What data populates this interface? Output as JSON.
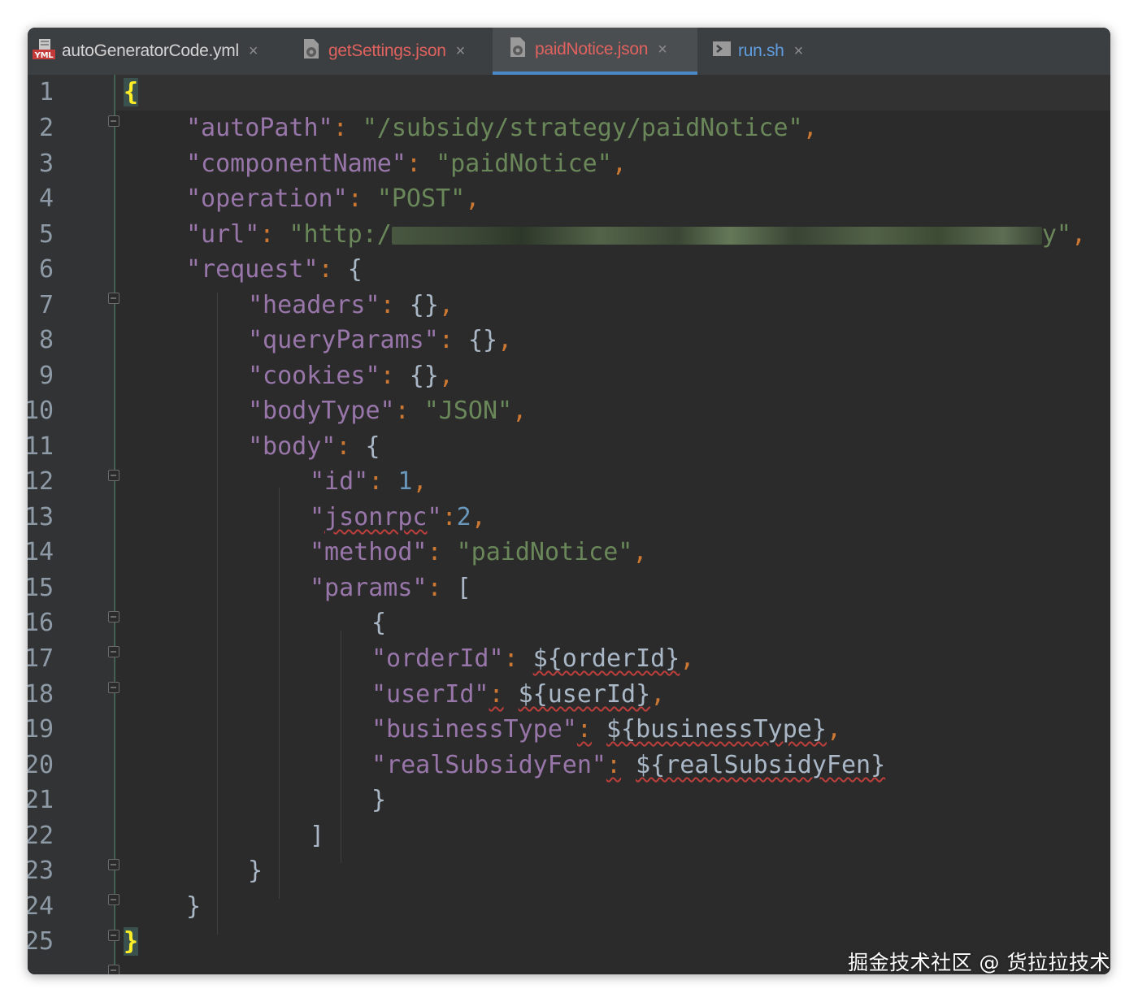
{
  "tabs": [
    {
      "label": "autoGeneratorCode.yml",
      "icon": "yml-file-icon",
      "color": "#d3d3d3",
      "active": false,
      "close": "×"
    },
    {
      "label": "getSettings.json",
      "icon": "json-file-icon",
      "color": "#e0625f",
      "active": false,
      "close": "×"
    },
    {
      "label": "paidNotice.json",
      "icon": "json-file-icon",
      "color": "#e0625f",
      "active": true,
      "close": "×"
    },
    {
      "label": "run.sh",
      "icon": "shell-file-icon",
      "color": "#5f9de0",
      "active": false,
      "close": "×"
    }
  ],
  "yml_badge": "YML",
  "line_numbers": [
    "1",
    "2",
    "3",
    "4",
    "5",
    "6",
    "7",
    "8",
    "9",
    "10",
    "11",
    "12",
    "13",
    "14",
    "15",
    "16",
    "17",
    "18",
    "19",
    "20",
    "21",
    "22",
    "23",
    "24",
    "25"
  ],
  "code": {
    "l1_open": "{",
    "autoPath_key": "\"autoPath\"",
    "autoPath_val": "\"/subsidy/strategy/paidNotice\"",
    "componentName_key": "\"componentName\"",
    "componentName_val": "\"paidNotice\"",
    "operation_key": "\"operation\"",
    "operation_val": "\"POST\"",
    "url_key": "\"url\"",
    "url_val_start": "\"http:/",
    "url_val_end": "y\"",
    "request_key": "\"request\"",
    "headers_key": "\"headers\"",
    "queryParams_key": "\"queryParams\"",
    "cookies_key": "\"cookies\"",
    "bodyType_key": "\"bodyType\"",
    "bodyType_val": "\"JSON\"",
    "body_key": "\"body\"",
    "id_key": "\"id\"",
    "id_val": "1",
    "jsonrpc_key_q1": "\"",
    "jsonrpc_key_word": "jsonrpc",
    "jsonrpc_key_q2": "\"",
    "jsonrpc_val": "2",
    "method_key": "\"method\"",
    "method_val": "\"paidNotice\"",
    "params_key": "\"params\"",
    "orderId_key": "\"orderId\"",
    "orderId_var": "${orderId}",
    "userId_key": "\"userId\"",
    "userId_var": "${userId}",
    "businessType_key": "\"businessType\"",
    "businessType_var": "${businessType}",
    "realSubsidyFen_key": "\"realSubsidyFen\"",
    "realSubsidyFen_var": "${realSubsidyFen}",
    "l25_close": "}"
  },
  "watermark": "掘金技术社区 @ 货拉拉技术",
  "colors": {
    "keyword": "#cc7832",
    "string": "#6a8759",
    "property": "#9876aa",
    "number": "#6897bb",
    "brace": "#a9b7c6",
    "active_tab_underline": "#4a88c7"
  }
}
